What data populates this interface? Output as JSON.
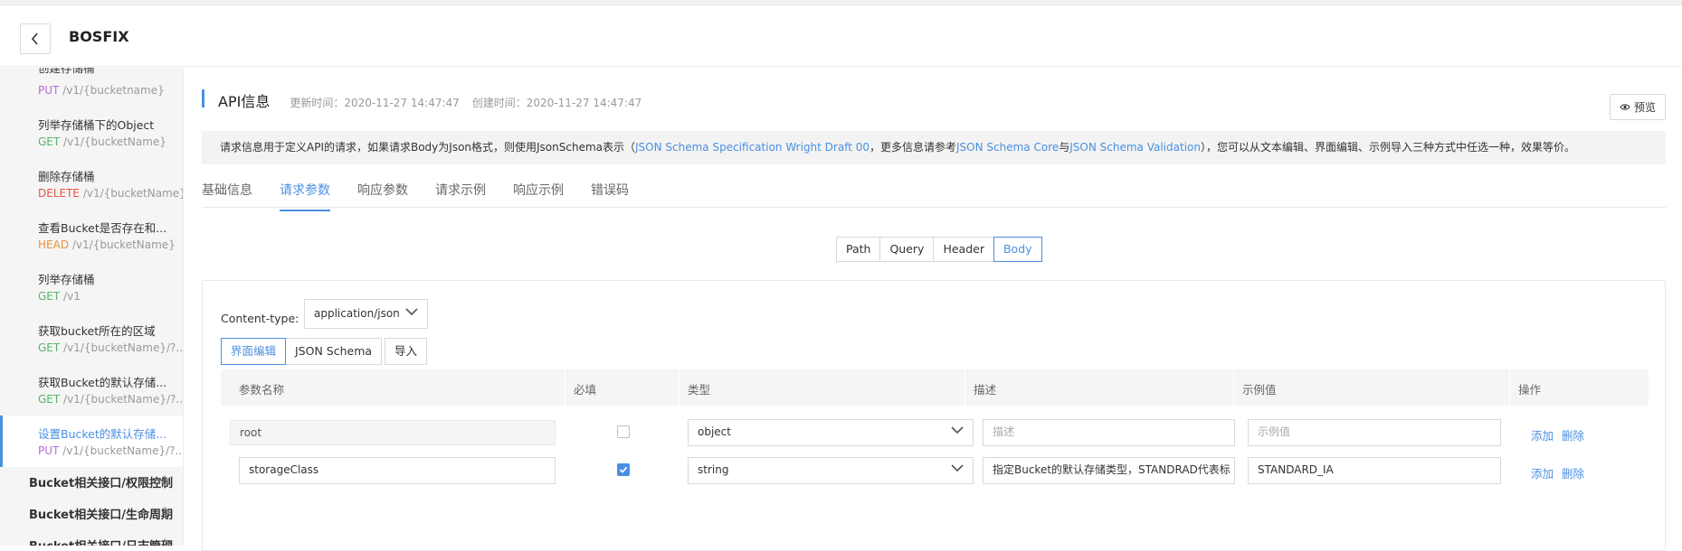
{
  "header": {
    "title": "BOSFIX"
  },
  "sidebar": {
    "partial_top_label": "创建存储桶",
    "items": [
      {
        "name": "",
        "method": "PUT",
        "path": "/v1/{bucketname}"
      },
      {
        "name": "列举存储桶下的Object",
        "method": "GET",
        "path": "/v1/{bucketName}"
      },
      {
        "name": "删除存储桶",
        "method": "DELETE",
        "path": "/v1/{bucketName}"
      },
      {
        "name": "查看Bucket是否存在和...",
        "method": "HEAD",
        "path": "/v1/{bucketName}"
      },
      {
        "name": "列举存储桶",
        "method": "GET",
        "path": "/v1"
      },
      {
        "name": "获取bucket所在的区域",
        "method": "GET",
        "path": "/v1/{bucketName}/?..."
      },
      {
        "name": "获取Bucket的默认存储...",
        "method": "GET",
        "path": "/v1/{bucketName}/?..."
      },
      {
        "name": "设置Bucket的默认存储...",
        "method": "PUT",
        "path": "/v1/{bucketName}/?..."
      }
    ],
    "groups": [
      {
        "label": "Bucket相关接口/权限控制"
      },
      {
        "label": "Bucket相关接口/生命周期"
      },
      {
        "label": "Bucket相关接口/日志管理"
      }
    ]
  },
  "api": {
    "title": "API信息",
    "updated": "更新时间：2020-11-27 14:47:47",
    "created": "创建时间：2020-11-27 14:47:47",
    "preview_label": "预览"
  },
  "info": {
    "t1": "请求信息用于定义API的请求，如果请求Body为Json格式，则使用JsonSchema表示（",
    "l1": "JSON Schema Specification Wright Draft 00",
    "t2": "，更多信息请参考",
    "l2": "JSON Schema Core",
    "t3": "与",
    "l3": "JSON Schema Validation",
    "t4": "），您可以从文本编辑、界面编辑、示例导入三种方式中任选一种，效果等价。"
  },
  "tabs": [
    "基础信息",
    "请求参数",
    "响应参数",
    "请求示例",
    "响应示例",
    "错误码"
  ],
  "segments": [
    "Path",
    "Query",
    "Header",
    "Body"
  ],
  "body": {
    "content_type_label": "Content-type:",
    "content_type_value": "application/json",
    "mode_ui": "界面编辑",
    "mode_schema": "JSON Schema",
    "import_label": "导入"
  },
  "table": {
    "headers": [
      "参数名称",
      "必填",
      "类型",
      "描述",
      "示例值",
      "操作"
    ],
    "rows": [
      {
        "name": "root",
        "required": false,
        "type": "object",
        "desc_placeholder": "描述",
        "example_placeholder": "示例值",
        "add": "添加",
        "delete": "删除"
      },
      {
        "name": "storageClass",
        "required": true,
        "type": "string",
        "desc": "指定Bucket的默认存储类型，STANDRAD代表标",
        "example": "STANDARD_IA",
        "add": "添加",
        "delete": "删除"
      }
    ]
  },
  "colors": {
    "accent": "#4a90e2",
    "put": "#b86ae0",
    "get": "#59b36b",
    "delete": "#e0564a",
    "head": "#e8913a"
  }
}
